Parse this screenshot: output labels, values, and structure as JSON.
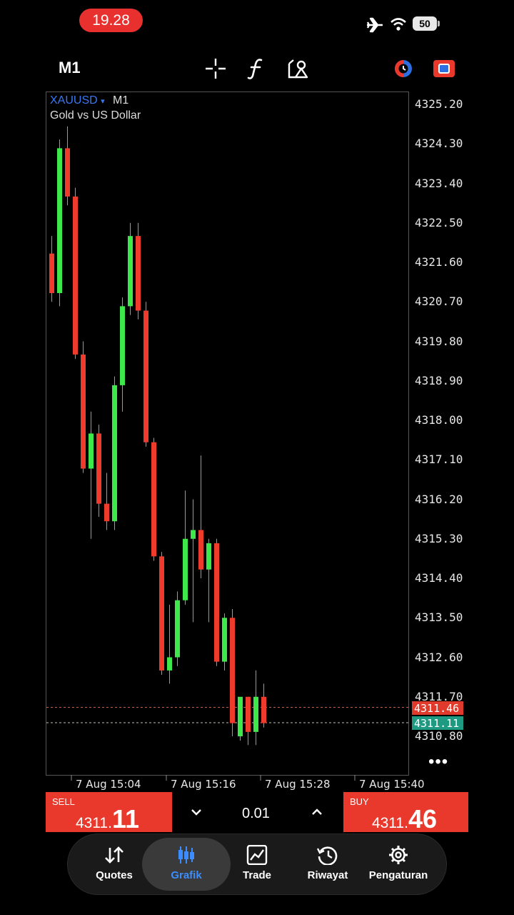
{
  "status_bar": {
    "time": "19.28",
    "battery": "50"
  },
  "toolbar": {
    "timeframe": "M1"
  },
  "chart": {
    "symbol": "XAUUSD",
    "symbol_arrow": "▾",
    "timeframe": "M1",
    "description": "Gold vs US Dollar",
    "bid_tag": "4311.46",
    "ask_tag": "4311.11",
    "more": "•••"
  },
  "colors": {
    "bull": "#3ee84a",
    "bear": "#ef3b2c",
    "accent": "#3c8dff",
    "sell_bg": "#e8392c",
    "buy_bg": "#e8392c"
  },
  "chart_data": {
    "type": "candlestick",
    "y_ticks": [
      "4325.20",
      "4324.30",
      "4323.40",
      "4322.50",
      "4321.60",
      "4320.70",
      "4319.80",
      "4318.90",
      "4318.00",
      "4317.10",
      "4316.20",
      "4315.30",
      "4314.40",
      "4313.50",
      "4312.60",
      "4311.70",
      "4310.80"
    ],
    "x_ticks": [
      "7 Aug 15:04",
      "7 Aug 15:16",
      "7 Aug 15:28",
      "7 Aug 15:40"
    ],
    "ylim": [
      4310.3,
      4325.5
    ],
    "bid_line": 4311.46,
    "ask_line": 4311.11,
    "candles": [
      {
        "o": 4321.8,
        "h": 4322.2,
        "l": 4320.7,
        "c": 4320.9
      },
      {
        "o": 4320.9,
        "h": 4324.4,
        "l": 4320.6,
        "c": 4324.2
      },
      {
        "o": 4324.2,
        "h": 4324.7,
        "l": 4322.9,
        "c": 4323.1
      },
      {
        "o": 4323.1,
        "h": 4323.3,
        "l": 4319.4,
        "c": 4319.5
      },
      {
        "o": 4319.5,
        "h": 4319.8,
        "l": 4316.8,
        "c": 4316.9
      },
      {
        "o": 4316.9,
        "h": 4318.2,
        "l": 4315.3,
        "c": 4317.7
      },
      {
        "o": 4317.7,
        "h": 4317.9,
        "l": 4315.8,
        "c": 4316.1
      },
      {
        "o": 4316.1,
        "h": 4316.8,
        "l": 4315.5,
        "c": 4315.7
      },
      {
        "o": 4315.7,
        "h": 4319.0,
        "l": 4315.5,
        "c": 4318.8
      },
      {
        "o": 4318.8,
        "h": 4320.8,
        "l": 4318.2,
        "c": 4320.6
      },
      {
        "o": 4320.6,
        "h": 4322.5,
        "l": 4320.4,
        "c": 4322.2
      },
      {
        "o": 4322.2,
        "h": 4322.5,
        "l": 4320.3,
        "c": 4320.5
      },
      {
        "o": 4320.5,
        "h": 4320.7,
        "l": 4317.4,
        "c": 4317.5
      },
      {
        "o": 4317.5,
        "h": 4317.6,
        "l": 4314.8,
        "c": 4314.9
      },
      {
        "o": 4314.9,
        "h": 4315.0,
        "l": 4312.2,
        "c": 4312.3
      },
      {
        "o": 4312.3,
        "h": 4313.8,
        "l": 4312.0,
        "c": 4312.6
      },
      {
        "o": 4312.6,
        "h": 4314.1,
        "l": 4312.4,
        "c": 4313.9
      },
      {
        "o": 4313.9,
        "h": 4316.4,
        "l": 4313.8,
        "c": 4315.3
      },
      {
        "o": 4315.3,
        "h": 4316.2,
        "l": 4313.4,
        "c": 4315.5
      },
      {
        "o": 4315.5,
        "h": 4317.2,
        "l": 4314.4,
        "c": 4314.6
      },
      {
        "o": 4314.6,
        "h": 4315.3,
        "l": 4313.4,
        "c": 4315.2
      },
      {
        "o": 4315.2,
        "h": 4315.3,
        "l": 4312.4,
        "c": 4312.5
      },
      {
        "o": 4312.5,
        "h": 4313.6,
        "l": 4312.3,
        "c": 4313.5
      },
      {
        "o": 4313.5,
        "h": 4313.7,
        "l": 4310.8,
        "c": 4311.1
      },
      {
        "o": 4310.8,
        "h": 4311.5,
        "l": 4310.7,
        "c": 4311.7
      },
      {
        "o": 4311.7,
        "h": 4311.7,
        "l": 4310.6,
        "c": 4310.9
      },
      {
        "o": 4310.9,
        "h": 4312.3,
        "l": 4310.6,
        "c": 4311.7
      },
      {
        "o": 4311.7,
        "h": 4312.0,
        "l": 4311.0,
        "c": 4311.1
      }
    ]
  },
  "trade": {
    "sell": {
      "label": "SELL",
      "price_small": "4311.",
      "price_big": "11"
    },
    "buy": {
      "label": "BUY",
      "price_small": "4311.",
      "price_big": "46"
    },
    "lot": "0.01",
    "lot_down": "⌄",
    "lot_up": "⌃"
  },
  "nav": {
    "items": [
      {
        "label": "Quotes"
      },
      {
        "label": "Grafik"
      },
      {
        "label": "Trade"
      },
      {
        "label": "Riwayat"
      },
      {
        "label": "Pengaturan"
      }
    ]
  }
}
